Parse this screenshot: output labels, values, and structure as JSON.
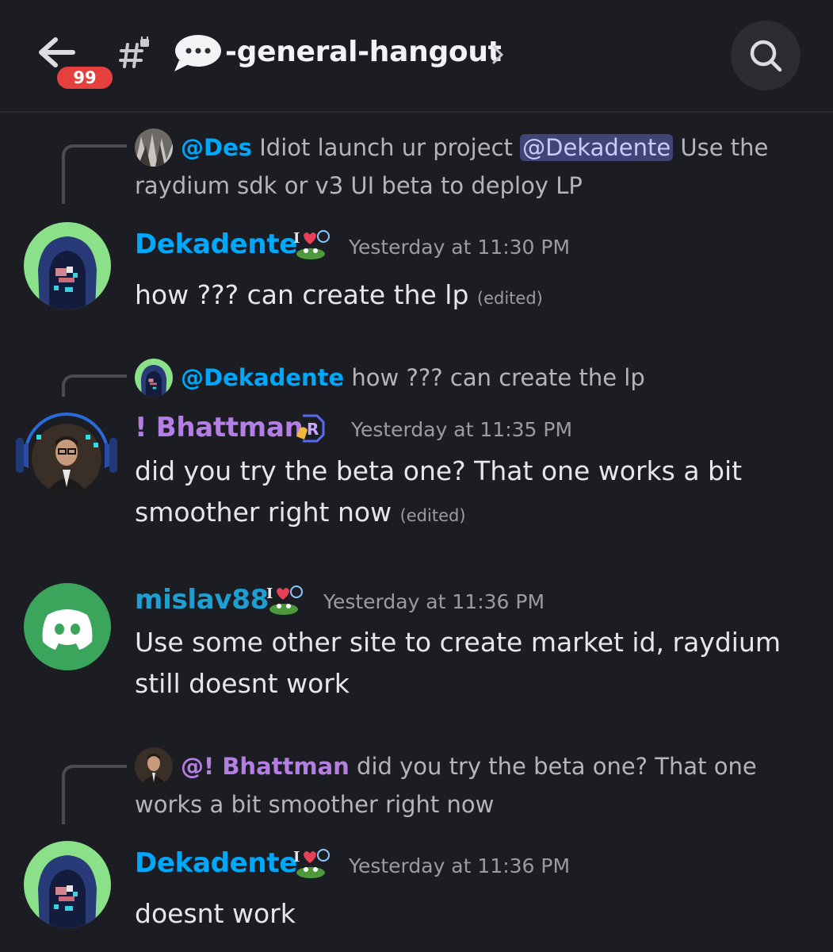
{
  "header": {
    "back_icon": "arrow-left-icon",
    "unread_badge": "99",
    "channel_icon": "locked-hash-icon",
    "channel_emoji": "speech-bubble-icon",
    "channel_name": "-general-hangout",
    "chevron_icon": "chevron-right-icon",
    "search_icon": "search-icon"
  },
  "messages": [
    {
      "reply": {
        "name": "@Des",
        "text_before": "Idiot launch ur project",
        "mention": "@Dekadente",
        "text_after": "Use the raydium sdk or v3 UI beta to deploy LP"
      },
      "author": "Dekadente",
      "timestamp": "Yesterday at 11:30 PM",
      "body": "how ??? can create the lp",
      "edited": "(edited)"
    },
    {
      "reply": {
        "name": "@Dekadente",
        "text": "how ??? can create the lp"
      },
      "author": "! Bhattman",
      "timestamp": "Yesterday at 11:35 PM",
      "body": "did you try the beta one? That one works a bit smoother right now",
      "edited": "(edited)"
    },
    {
      "author": "mislav88",
      "timestamp": "Yesterday at 11:36 PM",
      "body": "Use some other site to create market id, raydium still doesnt work"
    },
    {
      "reply": {
        "name": "@! Bhattman",
        "text": "did you try the beta one? That one works a bit smoother right now"
      },
      "author": "Dekadente",
      "timestamp": "Yesterday at 11:36 PM",
      "body": "doesnt work"
    }
  ],
  "colors": {
    "background": "#1c1d22",
    "mention_blue": "#00a8fc",
    "role_purple": "#b57ee5",
    "discord_green": "#3ba55c",
    "badge_red": "#e5403e"
  }
}
